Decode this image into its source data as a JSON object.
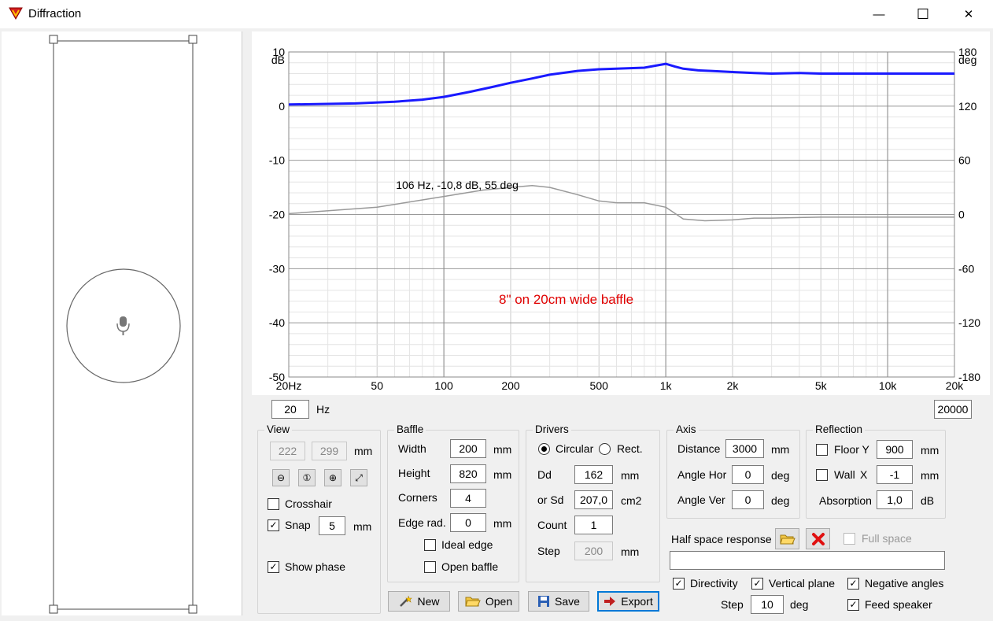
{
  "window": {
    "title": "Diffraction",
    "min_glyph": "—",
    "max_glyph": "☐",
    "close_glyph": "✕"
  },
  "chart_data": {
    "type": "line",
    "x_ticks": [
      "20Hz",
      "50",
      "100",
      "200",
      "500",
      "1k",
      "2k",
      "5k",
      "10k",
      "20k"
    ],
    "y_left_ticks": [
      "10",
      "0",
      "-10",
      "-20",
      "-30",
      "-40",
      "-50"
    ],
    "y_left_unit": "dB",
    "y_right_ticks": [
      "180",
      "120",
      "60",
      "0",
      "-60",
      "-120",
      "-180"
    ],
    "y_right_unit": "deg",
    "xlim": [
      20,
      20000
    ],
    "ylim": [
      -50,
      10
    ],
    "y2lim": [
      -180,
      180
    ],
    "x_scale": "log",
    "grid": true,
    "annotation": "8\" on 20cm wide baffle",
    "crosshair_readout": "106 Hz, -10,8 dB, 55 deg",
    "series": [
      {
        "color": "#1a1aff",
        "axis": "left",
        "x": [
          20,
          40,
          60,
          80,
          100,
          130,
          160,
          200,
          250,
          300,
          400,
          500,
          600,
          800,
          1000,
          1100,
          1200,
          1400,
          1600,
          2000,
          2500,
          3000,
          4000,
          5000,
          7000,
          10000,
          15000,
          20000
        ],
        "y": [
          0.3,
          0.5,
          0.8,
          1.2,
          1.7,
          2.6,
          3.4,
          4.3,
          5.1,
          5.8,
          6.5,
          6.8,
          6.9,
          7.1,
          7.8,
          7.3,
          6.9,
          6.6,
          6.5,
          6.3,
          6.1,
          6.0,
          6.1,
          6.0,
          6.0,
          6.0,
          6.0,
          6.0
        ]
      },
      {
        "color": "#999999",
        "axis": "right",
        "x": [
          20,
          50,
          100,
          150,
          200,
          250,
          300,
          400,
          500,
          600,
          800,
          1000,
          1200,
          1500,
          2000,
          2500,
          3000,
          5000,
          10000,
          20000
        ],
        "y": [
          1,
          8,
          20,
          27,
          30,
          32,
          30,
          22,
          15,
          13,
          13,
          8,
          -5,
          -7,
          -6,
          -4,
          -4,
          -3,
          -3,
          -3
        ]
      }
    ]
  },
  "freq_min": "20",
  "freq_unit": "Hz",
  "freq_max": "20000",
  "view": {
    "label": "View",
    "x": "222",
    "y": "299",
    "unit": "mm",
    "crosshair": "Crosshair",
    "crosshair_checked": false,
    "snap": "Snap",
    "snap_checked": true,
    "snap_value": "5",
    "snap_unit": "mm",
    "show_phase": "Show phase",
    "show_phase_checked": true
  },
  "baffle": {
    "label": "Baffle",
    "width_label": "Width",
    "width": "200",
    "height_label": "Height",
    "height": "820",
    "corners_label": "Corners",
    "corners": "4",
    "edge_label": "Edge rad.",
    "edge": "0",
    "unit": "mm",
    "ideal_edge": "Ideal edge",
    "open_baffle": "Open baffle"
  },
  "drivers": {
    "label": "Drivers",
    "circular": "Circular",
    "rect": "Rect.",
    "dd_label": "Dd",
    "dd": "162",
    "dd_unit": "mm",
    "sd_label": "or Sd",
    "sd": "207,0",
    "sd_unit": "cm2",
    "count_label": "Count",
    "count": "1",
    "step_label": "Step",
    "step": "200",
    "step_unit": "mm"
  },
  "axis": {
    "label": "Axis",
    "distance_label": "Distance",
    "distance": "3000",
    "distance_unit": "mm",
    "hor_label": "Angle Hor",
    "hor": "0",
    "ver_label": "Angle Ver",
    "ver": "0",
    "deg": "deg"
  },
  "reflection": {
    "label": "Reflection",
    "floor_label": "Floor Y",
    "floor": "900",
    "wall_label": "Wall",
    "wall_axis": "X",
    "wall": "-1",
    "unit": "mm",
    "absorption_label": "Absorption",
    "absorption": "1,0",
    "absorption_unit": "dB"
  },
  "half_space": {
    "label": "Half space response",
    "full_space": "Full space",
    "path": ""
  },
  "directivity": {
    "directivity": "Directivity",
    "vertical": "Vertical plane",
    "negative": "Negative angles",
    "step_label": "Step",
    "step": "10",
    "step_unit": "deg",
    "feed": "Feed speaker"
  },
  "buttons": {
    "new": "New",
    "open": "Open",
    "save": "Save",
    "export": "Export"
  }
}
